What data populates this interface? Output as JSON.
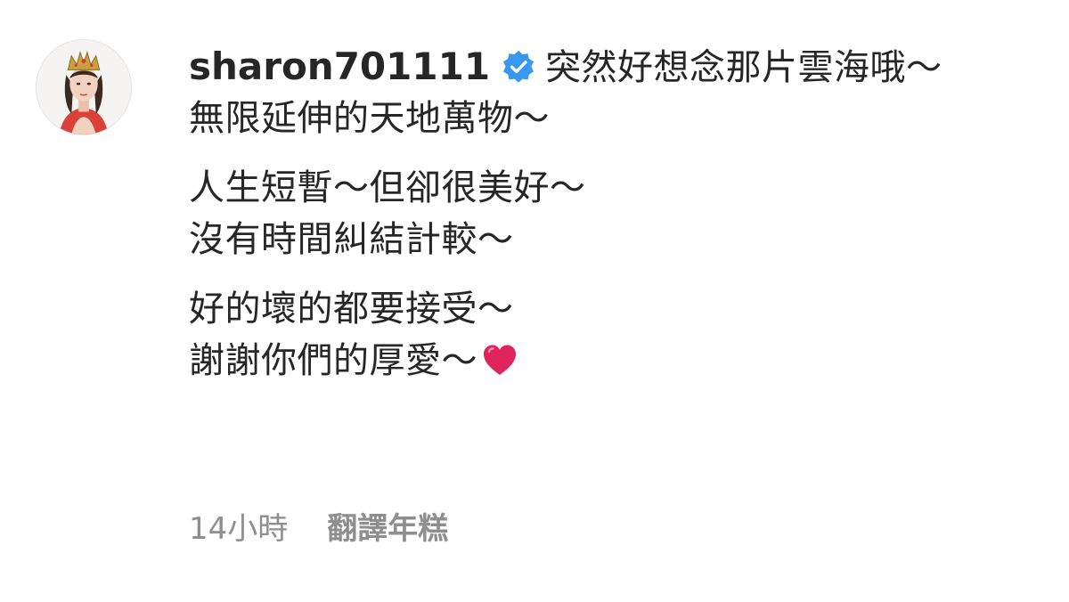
{
  "post": {
    "username": "sharon701111",
    "verified": true,
    "caption_lines": [
      "突然好想念那片雲海哦～",
      "無限延伸的天地萬物～",
      "",
      "人生短暫～但卻很美好～",
      "沒有時間糾結計較～",
      "",
      "好的壞的都要接受～",
      "謝謝你們的厚愛～"
    ],
    "caption_end_emoji": "red-heart-icon",
    "timestamp": "14小時",
    "translate_label": "翻譯年糕"
  },
  "colors": {
    "text": "#262626",
    "meta_text": "#8e8e8e",
    "verified_badge": "#3897f0",
    "heart": "#e0245e"
  },
  "icons": {
    "avatar": "profile-avatar-crowned-woman",
    "verified": "verified-badge-icon",
    "heart": "red-heart-icon"
  }
}
